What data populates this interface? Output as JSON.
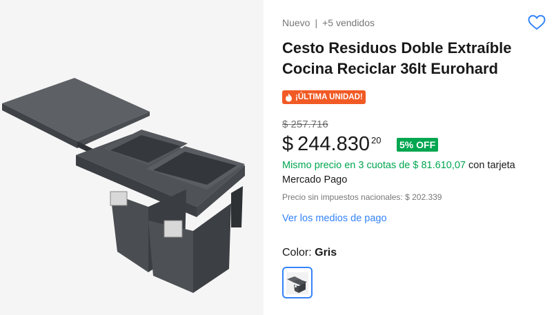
{
  "product": {
    "condition": "Nuevo",
    "separator": "|",
    "sold": "+5 vendidos",
    "title": "Cesto Residuos Doble Extraíble Cocina Reciclar 36lt Eurohard",
    "badge": "¡ÚLTIMA UNIDAD!",
    "badge_color": "#f15a24"
  },
  "pricing": {
    "original_price": "$ 257.716",
    "currency": "$",
    "price": "244.830",
    "cents": "20",
    "discount": "5% OFF",
    "discount_color": "#00a650",
    "installments_highlight": "Mismo precio en 3 cuotas de $ 81.610,07",
    "installments_rest": " con tarjeta Mercado Pago",
    "taxes": "Precio sin impuestos nacionales: $ 202.339"
  },
  "payment_link": "Ver los medios de pago",
  "variant": {
    "label": "Color: ",
    "value": "Gris"
  },
  "icons": {
    "favorite": "heart-outline-icon",
    "badge": "flame-icon"
  },
  "colors": {
    "accent": "#3483fa",
    "green": "#00a650"
  }
}
